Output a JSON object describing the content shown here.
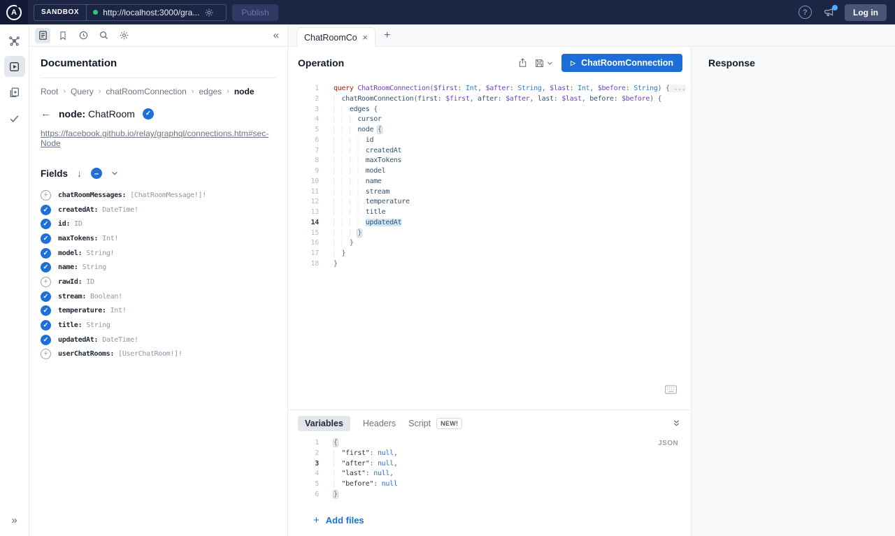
{
  "topbar": {
    "logo_letter": "A",
    "sandbox_label": "SANDBOX",
    "url": "http://localhost:3000/gra...",
    "publish_label": "Publish",
    "login_label": "Log in",
    "help_glyph": "?"
  },
  "tabs": {
    "active_tab": "ChatRoomCo...",
    "close_glyph": "×",
    "new_tab_glyph": "+"
  },
  "collapse_glyphs": {
    "left": "«",
    "right": "»",
    "back_arrow": "←",
    "sort_arrow": "↓"
  },
  "docs": {
    "title": "Documentation",
    "breadcrumb": [
      "Root",
      "Query",
      "chatRoomConnection",
      "edges",
      "node"
    ],
    "breadcrumb_separator": "›",
    "node_label": "node:",
    "node_type": "ChatRoom",
    "link": "https://facebook.github.io/relay/graphql/connections.htm#sec-Node",
    "fields_label": "Fields",
    "fields": [
      {
        "name": "chatRoomMessages",
        "type": "[ChatRoomMessage!]!",
        "selected": false
      },
      {
        "name": "createdAt",
        "type": "DateTime!",
        "selected": true
      },
      {
        "name": "id",
        "type": "ID",
        "selected": true
      },
      {
        "name": "maxTokens",
        "type": "Int!",
        "selected": true
      },
      {
        "name": "model",
        "type": "String!",
        "selected": true
      },
      {
        "name": "name",
        "type": "String",
        "selected": true
      },
      {
        "name": "rawId",
        "type": "ID",
        "selected": false
      },
      {
        "name": "stream",
        "type": "Boolean!",
        "selected": true
      },
      {
        "name": "temperature",
        "type": "Int!",
        "selected": true
      },
      {
        "name": "title",
        "type": "String",
        "selected": true
      },
      {
        "name": "updatedAt",
        "type": "DateTime!",
        "selected": true
      },
      {
        "name": "userChatRooms",
        "type": "[UserChatRoom!]!",
        "selected": false
      }
    ]
  },
  "operation": {
    "title": "Operation",
    "run_label": "ChatRoomConnection",
    "play_glyph": "▷",
    "lines": [
      {
        "n": 1,
        "ind": 0,
        "tokens": [
          [
            "k",
            "query"
          ],
          [
            "p",
            " "
          ],
          [
            "d",
            "ChatRoomConnection"
          ],
          [
            "p",
            "("
          ],
          [
            "v",
            "$first"
          ],
          [
            "p",
            ": "
          ],
          [
            "t",
            "Int"
          ],
          [
            "p",
            ", "
          ],
          [
            "v",
            "$after"
          ],
          [
            "p",
            ": "
          ],
          [
            "t",
            "String"
          ],
          [
            "p",
            ", "
          ],
          [
            "v",
            "$last"
          ],
          [
            "p",
            ": "
          ],
          [
            "t",
            "Int"
          ],
          [
            "p",
            ", "
          ],
          [
            "v",
            "$before"
          ],
          [
            "p",
            ": "
          ],
          [
            "t",
            "String"
          ],
          [
            "p",
            ") {"
          ],
          [
            "e",
            " ..."
          ]
        ]
      },
      {
        "n": 2,
        "ind": 2,
        "tokens": [
          [
            "f",
            "chatRoomConnection"
          ],
          [
            "p",
            "("
          ],
          [
            "f",
            "first"
          ],
          [
            "p",
            ": "
          ],
          [
            "v",
            "$first"
          ],
          [
            "p",
            ", "
          ],
          [
            "f",
            "after"
          ],
          [
            "p",
            ": "
          ],
          [
            "v",
            "$after"
          ],
          [
            "p",
            ", "
          ],
          [
            "f",
            "last"
          ],
          [
            "p",
            ": "
          ],
          [
            "v",
            "$last"
          ],
          [
            "p",
            ", "
          ],
          [
            "f",
            "before"
          ],
          [
            "p",
            ": "
          ],
          [
            "v",
            "$before"
          ],
          [
            "p",
            ") {"
          ]
        ]
      },
      {
        "n": 3,
        "ind": 4,
        "tokens": [
          [
            "f",
            "edges"
          ],
          [
            "p",
            " {"
          ]
        ]
      },
      {
        "n": 4,
        "ind": 6,
        "tokens": [
          [
            "f",
            "cursor"
          ]
        ]
      },
      {
        "n": 5,
        "ind": 6,
        "tokens": [
          [
            "f",
            "node"
          ],
          [
            "p",
            " "
          ],
          [
            "pb",
            "{"
          ]
        ]
      },
      {
        "n": 6,
        "ind": 8,
        "tokens": [
          [
            "f",
            "id"
          ]
        ]
      },
      {
        "n": 7,
        "ind": 8,
        "tokens": [
          [
            "f",
            "createdAt"
          ]
        ]
      },
      {
        "n": 8,
        "ind": 8,
        "tokens": [
          [
            "f",
            "maxTokens"
          ]
        ]
      },
      {
        "n": 9,
        "ind": 8,
        "tokens": [
          [
            "f",
            "model"
          ]
        ]
      },
      {
        "n": 10,
        "ind": 8,
        "tokens": [
          [
            "f",
            "name"
          ]
        ]
      },
      {
        "n": 11,
        "ind": 8,
        "tokens": [
          [
            "f",
            "stream"
          ]
        ]
      },
      {
        "n": 12,
        "ind": 8,
        "tokens": [
          [
            "f",
            "temperature"
          ]
        ]
      },
      {
        "n": 13,
        "ind": 8,
        "tokens": [
          [
            "f",
            "title"
          ]
        ]
      },
      {
        "n": 14,
        "ind": 8,
        "active": true,
        "tokens": [
          [
            "fh",
            "updatedAt"
          ]
        ]
      },
      {
        "n": 15,
        "ind": 6,
        "tokens": [
          [
            "pb",
            "}"
          ]
        ]
      },
      {
        "n": 16,
        "ind": 4,
        "tokens": [
          [
            "p",
            "}"
          ]
        ]
      },
      {
        "n": 17,
        "ind": 2,
        "tokens": [
          [
            "p",
            "}"
          ]
        ]
      },
      {
        "n": 18,
        "ind": 0,
        "tokens": [
          [
            "p",
            "}"
          ]
        ]
      }
    ]
  },
  "variables": {
    "tabs": [
      "Variables",
      "Headers",
      "Script"
    ],
    "new_badge": "NEW!",
    "json_label": "JSON",
    "add_files": "Add files",
    "plus_glyph": "+",
    "lines": [
      {
        "n": 1,
        "ind": 0,
        "tokens": [
          [
            "pb",
            "{"
          ]
        ]
      },
      {
        "n": 2,
        "ind": 2,
        "tokens": [
          [
            "s",
            "\"first\""
          ],
          [
            "p",
            ": "
          ],
          [
            "nu",
            "null"
          ],
          [
            "p",
            ","
          ]
        ]
      },
      {
        "n": 3,
        "ind": 2,
        "active": true,
        "tokens": [
          [
            "s",
            "\"after\""
          ],
          [
            "p",
            ": "
          ],
          [
            "nu",
            "null"
          ],
          [
            "p",
            ","
          ]
        ]
      },
      {
        "n": 4,
        "ind": 2,
        "tokens": [
          [
            "s",
            "\"last\""
          ],
          [
            "p",
            ": "
          ],
          [
            "nu",
            "null"
          ],
          [
            "p",
            ","
          ]
        ]
      },
      {
        "n": 5,
        "ind": 2,
        "tokens": [
          [
            "s",
            "\"before\""
          ],
          [
            "p",
            ": "
          ],
          [
            "nu",
            "null"
          ]
        ]
      },
      {
        "n": 6,
        "ind": 0,
        "tokens": [
          [
            "pb",
            "}"
          ]
        ]
      }
    ]
  },
  "response": {
    "title": "Response"
  }
}
